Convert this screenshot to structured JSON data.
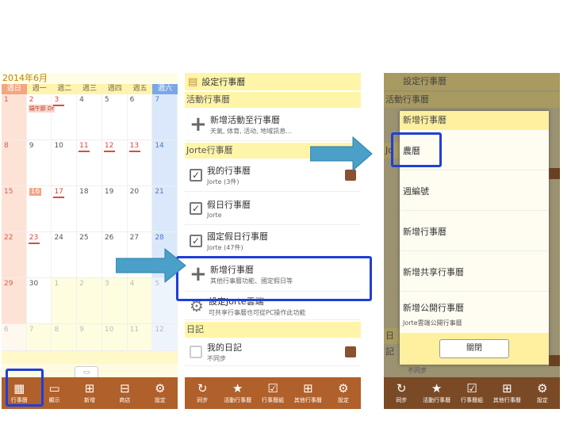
{
  "screen1": {
    "month_title": "2014年6月",
    "weekdays": [
      "週日",
      "週一",
      "週二",
      "週三",
      "週四",
      "週五",
      "週六"
    ],
    "weeks": [
      [
        {
          "n": "1"
        },
        {
          "n": "2",
          "ev": "端午節 Dr"
        },
        {
          "n": "3"
        },
        {
          "n": "4"
        },
        {
          "n": "5"
        },
        {
          "n": "6"
        },
        {
          "n": "7"
        }
      ],
      [
        {
          "n": "8"
        },
        {
          "n": "9"
        },
        {
          "n": "10"
        },
        {
          "n": "11"
        },
        {
          "n": "12"
        },
        {
          "n": "13"
        },
        {
          "n": "14"
        }
      ],
      [
        {
          "n": "15"
        },
        {
          "n": "16"
        },
        {
          "n": "17"
        },
        {
          "n": "18"
        },
        {
          "n": "19"
        },
        {
          "n": "20"
        },
        {
          "n": "21"
        }
      ],
      [
        {
          "n": "22"
        },
        {
          "n": "23"
        },
        {
          "n": "24"
        },
        {
          "n": "25"
        },
        {
          "n": "26"
        },
        {
          "n": "27"
        },
        {
          "n": "28"
        }
      ],
      [
        {
          "n": "29"
        },
        {
          "n": "30"
        },
        {
          "n": "1"
        },
        {
          "n": "2"
        },
        {
          "n": "3"
        },
        {
          "n": "4"
        },
        {
          "n": "5"
        }
      ],
      [
        {
          "n": "6"
        },
        {
          "n": "7"
        },
        {
          "n": "8"
        },
        {
          "n": "9"
        },
        {
          "n": "10"
        },
        {
          "n": "11"
        },
        {
          "n": "12"
        }
      ]
    ],
    "toolbar": [
      "行事曆",
      "顯示",
      "新增",
      "商店",
      "設定"
    ]
  },
  "screen2": {
    "title": "設定行事曆",
    "sec_activity": "活動行事曆",
    "add_activity": {
      "t1": "新增活動至行事曆",
      "t2": "天氣, 体育, 活动, 地域訊息..."
    },
    "sec_jorte": "Jorte行事曆",
    "my_cal": {
      "t1": "我的行事曆",
      "t2": "Jorte (3件)"
    },
    "holiday_cal": {
      "t1": "假日行事曆",
      "t2": "Jorte"
    },
    "national_cal": {
      "t1": "國定假日行事曆",
      "t2": "Jorte (47件)"
    },
    "new_cal": {
      "t1": "新增行事曆",
      "t2": "其他行事曆功能、國定假日等"
    },
    "cloud": {
      "t1": "設定Jorte雲端",
      "t2": "可共享行事曆也可從PC操作此功能"
    },
    "sec_diary": "日記",
    "my_diary": {
      "t1": "我的日記",
      "t2": "不同步"
    },
    "toolbar": [
      "同步",
      "活動行事曆",
      "行事曆組",
      "其他行事曆",
      "設定"
    ]
  },
  "screen3": {
    "title": "設定行事曆",
    "sec_activity": "活動行事曆",
    "sec_jorte": "Jo",
    "sec_diary": "日記",
    "diary_sub": "不同步",
    "dialog_title": "新增行事曆",
    "items": [
      {
        "t1": "農曆"
      },
      {
        "t1": "週編號"
      },
      {
        "t1": "新增行事曆"
      },
      {
        "t1": "新增共享行事曆"
      },
      {
        "t1": "新增公開行事曆",
        "t2": "Jorte雲端公開行事曆"
      }
    ],
    "close": "關閉",
    "toolbar": [
      "同步",
      "活動行事曆",
      "行事曆組",
      "其他行事曆",
      "設定"
    ]
  },
  "colors": {
    "toolbar": "#b0602a",
    "header": "#fff5a8",
    "highlight": "#1f3fd8",
    "arrow": "#4aa0c8"
  }
}
